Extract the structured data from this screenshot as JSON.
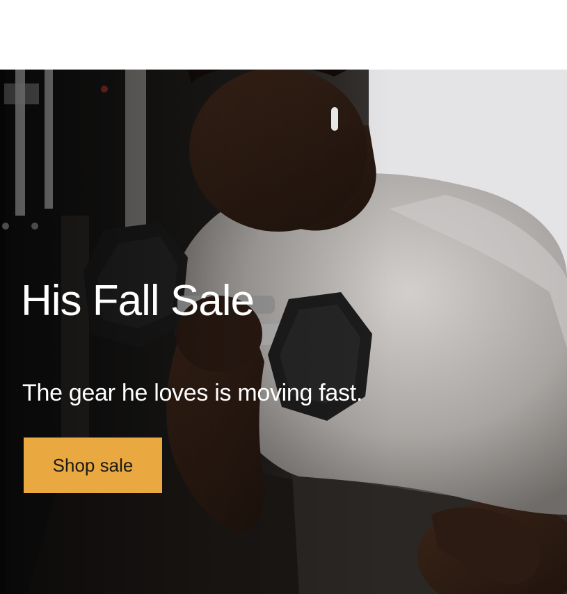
{
  "hero": {
    "title": "His Fall Sale",
    "subtitle": "The gear he loves is moving fast.",
    "cta_label": "Shop sale",
    "image_subject": "man-curling-dumbbell-photo"
  },
  "colors": {
    "cta_background": "#e9a840",
    "cta_text": "#1c1a17",
    "hero_text": "#ffffff",
    "page_background": "#ffffff"
  }
}
